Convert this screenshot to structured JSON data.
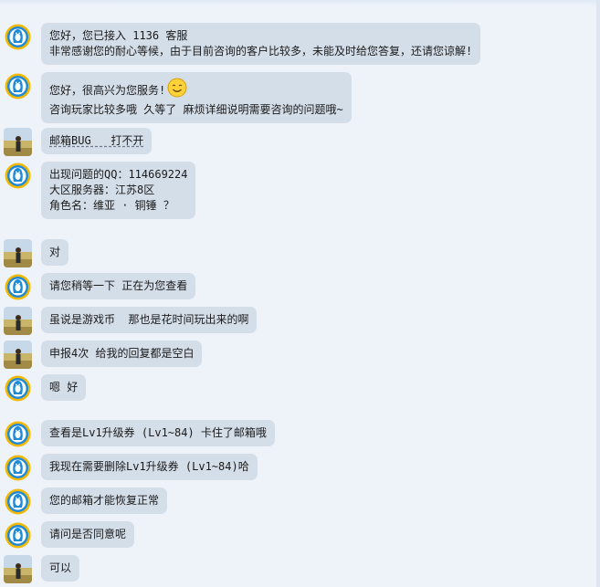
{
  "colors": {
    "background": "#eef3fa",
    "bubble": "#d4dee9",
    "text": "#1a1a1a",
    "qq_blue": "#1f8ad8",
    "qq_yellow": "#f5b800"
  },
  "avatars": {
    "agent": "qq-penguin-icon",
    "user": "user-photo-avatar"
  },
  "messages": [
    {
      "sender": "agent",
      "lines": [
        "您好，您已接入 1136 客服",
        "非常感谢您的耐心等候，由于目前咨询的客户比较多，未能及时给您答复，还请您谅解!"
      ]
    },
    {
      "sender": "agent",
      "lines": [
        "您好，很高兴为您服务!",
        "咨询玩家比较多哦 久等了 麻烦详细说明需要咨询的问题哦~"
      ],
      "emoji": "smiley-face-icon"
    },
    {
      "sender": "user",
      "lines": [
        "邮箱BUG   打不开"
      ]
    },
    {
      "sender": "agent",
      "lines": [
        "出现问题的QQ：114669224",
        "大区服务器：江苏8区",
        "角色名：维亚 · 铜锤 ？"
      ]
    },
    {
      "sender": "user",
      "lines": [
        "对"
      ]
    },
    {
      "sender": "agent",
      "lines": [
        "请您稍等一下 正在为您查看"
      ]
    },
    {
      "sender": "user",
      "lines": [
        "虽说是游戏币  那也是花时间玩出来的啊"
      ]
    },
    {
      "sender": "user",
      "lines": [
        "申报4次 给我的回复都是空白"
      ]
    },
    {
      "sender": "agent",
      "lines": [
        "嗯 好"
      ]
    },
    {
      "sender": "agent",
      "lines": [
        "查看是Lv1升级券 (Lv1~84) 卡住了邮箱哦"
      ]
    },
    {
      "sender": "agent",
      "lines": [
        "我现在需要删除Lv1升级券 (Lv1~84)哈"
      ]
    },
    {
      "sender": "agent",
      "lines": [
        "您的邮箱才能恢复正常"
      ]
    },
    {
      "sender": "agent",
      "lines": [
        "请问是否同意呢"
      ]
    },
    {
      "sender": "user",
      "lines": [
        "可以"
      ]
    }
  ]
}
